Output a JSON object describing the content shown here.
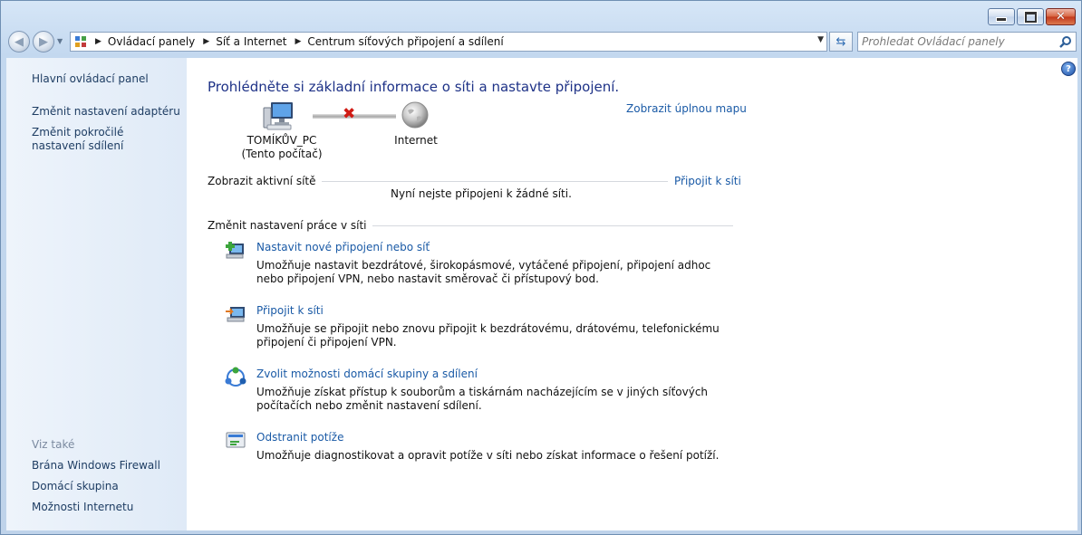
{
  "address_bar": {
    "crumbs": [
      "Ovládací panely",
      "Síť a Internet",
      "Centrum síťových připojení a sdílení"
    ]
  },
  "search": {
    "placeholder": "Prohledat Ovládací panely"
  },
  "sidebar": {
    "items": [
      "Hlavní ovládací panel",
      "Změnit nastavení adaptéru",
      "Změnit pokročilé nastavení sdílení"
    ],
    "see_also_label": "Viz také",
    "see_also": [
      "Brána Windows Firewall",
      "Domácí skupina",
      "Možnosti Internetu"
    ]
  },
  "main": {
    "heading": "Prohlédněte si základní informace o síti a nastavte připojení.",
    "full_map_link": "Zobrazit úplnou mapu",
    "network_map": {
      "computer_name": "TOMÍKŮV_PC",
      "computer_sub": "(Tento počítač)",
      "internet_label": "Internet"
    },
    "active_networks": {
      "title": "Zobrazit aktivní sítě",
      "connect_link": "Připojit k síti",
      "status": "Nyní nejste připojeni k žádné síti."
    },
    "change_settings": {
      "title": "Změnit nastavení práce v síti",
      "tasks": [
        {
          "label": "Nastavit nové připojení nebo síť",
          "desc": "Umožňuje nastavit bezdrátové, širokopásmové, vytáčené připojení, připojení adhoc nebo připojení VPN, nebo nastavit směrovač či přístupový bod."
        },
        {
          "label": "Připojit k síti",
          "desc": "Umožňuje se připojit nebo znovu připojit k bezdrátovému, drátovému, telefonickému připojení či připojení VPN."
        },
        {
          "label": "Zvolit možnosti domácí skupiny a sdílení",
          "desc": "Umožňuje získat přístup k souborům a tiskárnám nacházejícím se v jiných síťových počítačích nebo změnit nastavení sdílení."
        },
        {
          "label": "Odstranit potíže",
          "desc": "Umožňuje diagnostikovat a opravit potíže v síti nebo získat informace o řešení potíží."
        }
      ]
    }
  },
  "colors": {
    "link": "#1a5aa6",
    "heading": "#1e3287",
    "disconnect_red": "#d01b14"
  }
}
